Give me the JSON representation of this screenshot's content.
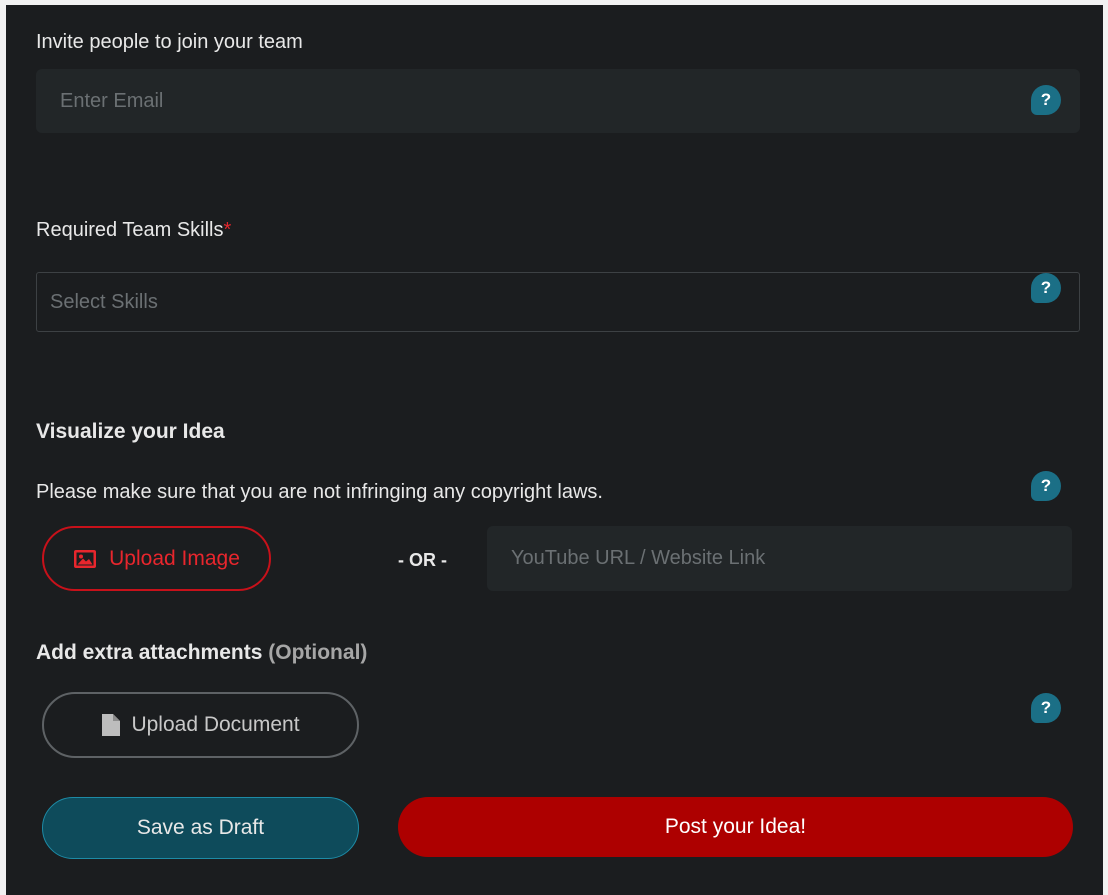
{
  "invite": {
    "label": "Invite people to join your team",
    "email_placeholder": "Enter Email",
    "help": "?"
  },
  "skills": {
    "label": "Required Team Skills",
    "required_mark": "*",
    "placeholder": "Select Skills",
    "help": "?"
  },
  "visualize": {
    "heading": "Visualize your Idea",
    "note": "Please make sure that you are not infringing any copyright laws.",
    "help": "?",
    "upload_image_label": "Upload Image",
    "or_label": "- OR -",
    "link_placeholder": "YouTube URL / Website Link"
  },
  "attachments": {
    "heading": "Add extra attachments",
    "optional": "(Optional)",
    "upload_document_label": "Upload Document",
    "help": "?"
  },
  "actions": {
    "save_draft_label": "Save as Draft",
    "post_label": "Post your Idea!"
  },
  "colors": {
    "background": "#1b1d1f",
    "accent_red": "#ad0000",
    "accent_teal": "#0e4b5b",
    "help_icon": "#1b6f86"
  }
}
